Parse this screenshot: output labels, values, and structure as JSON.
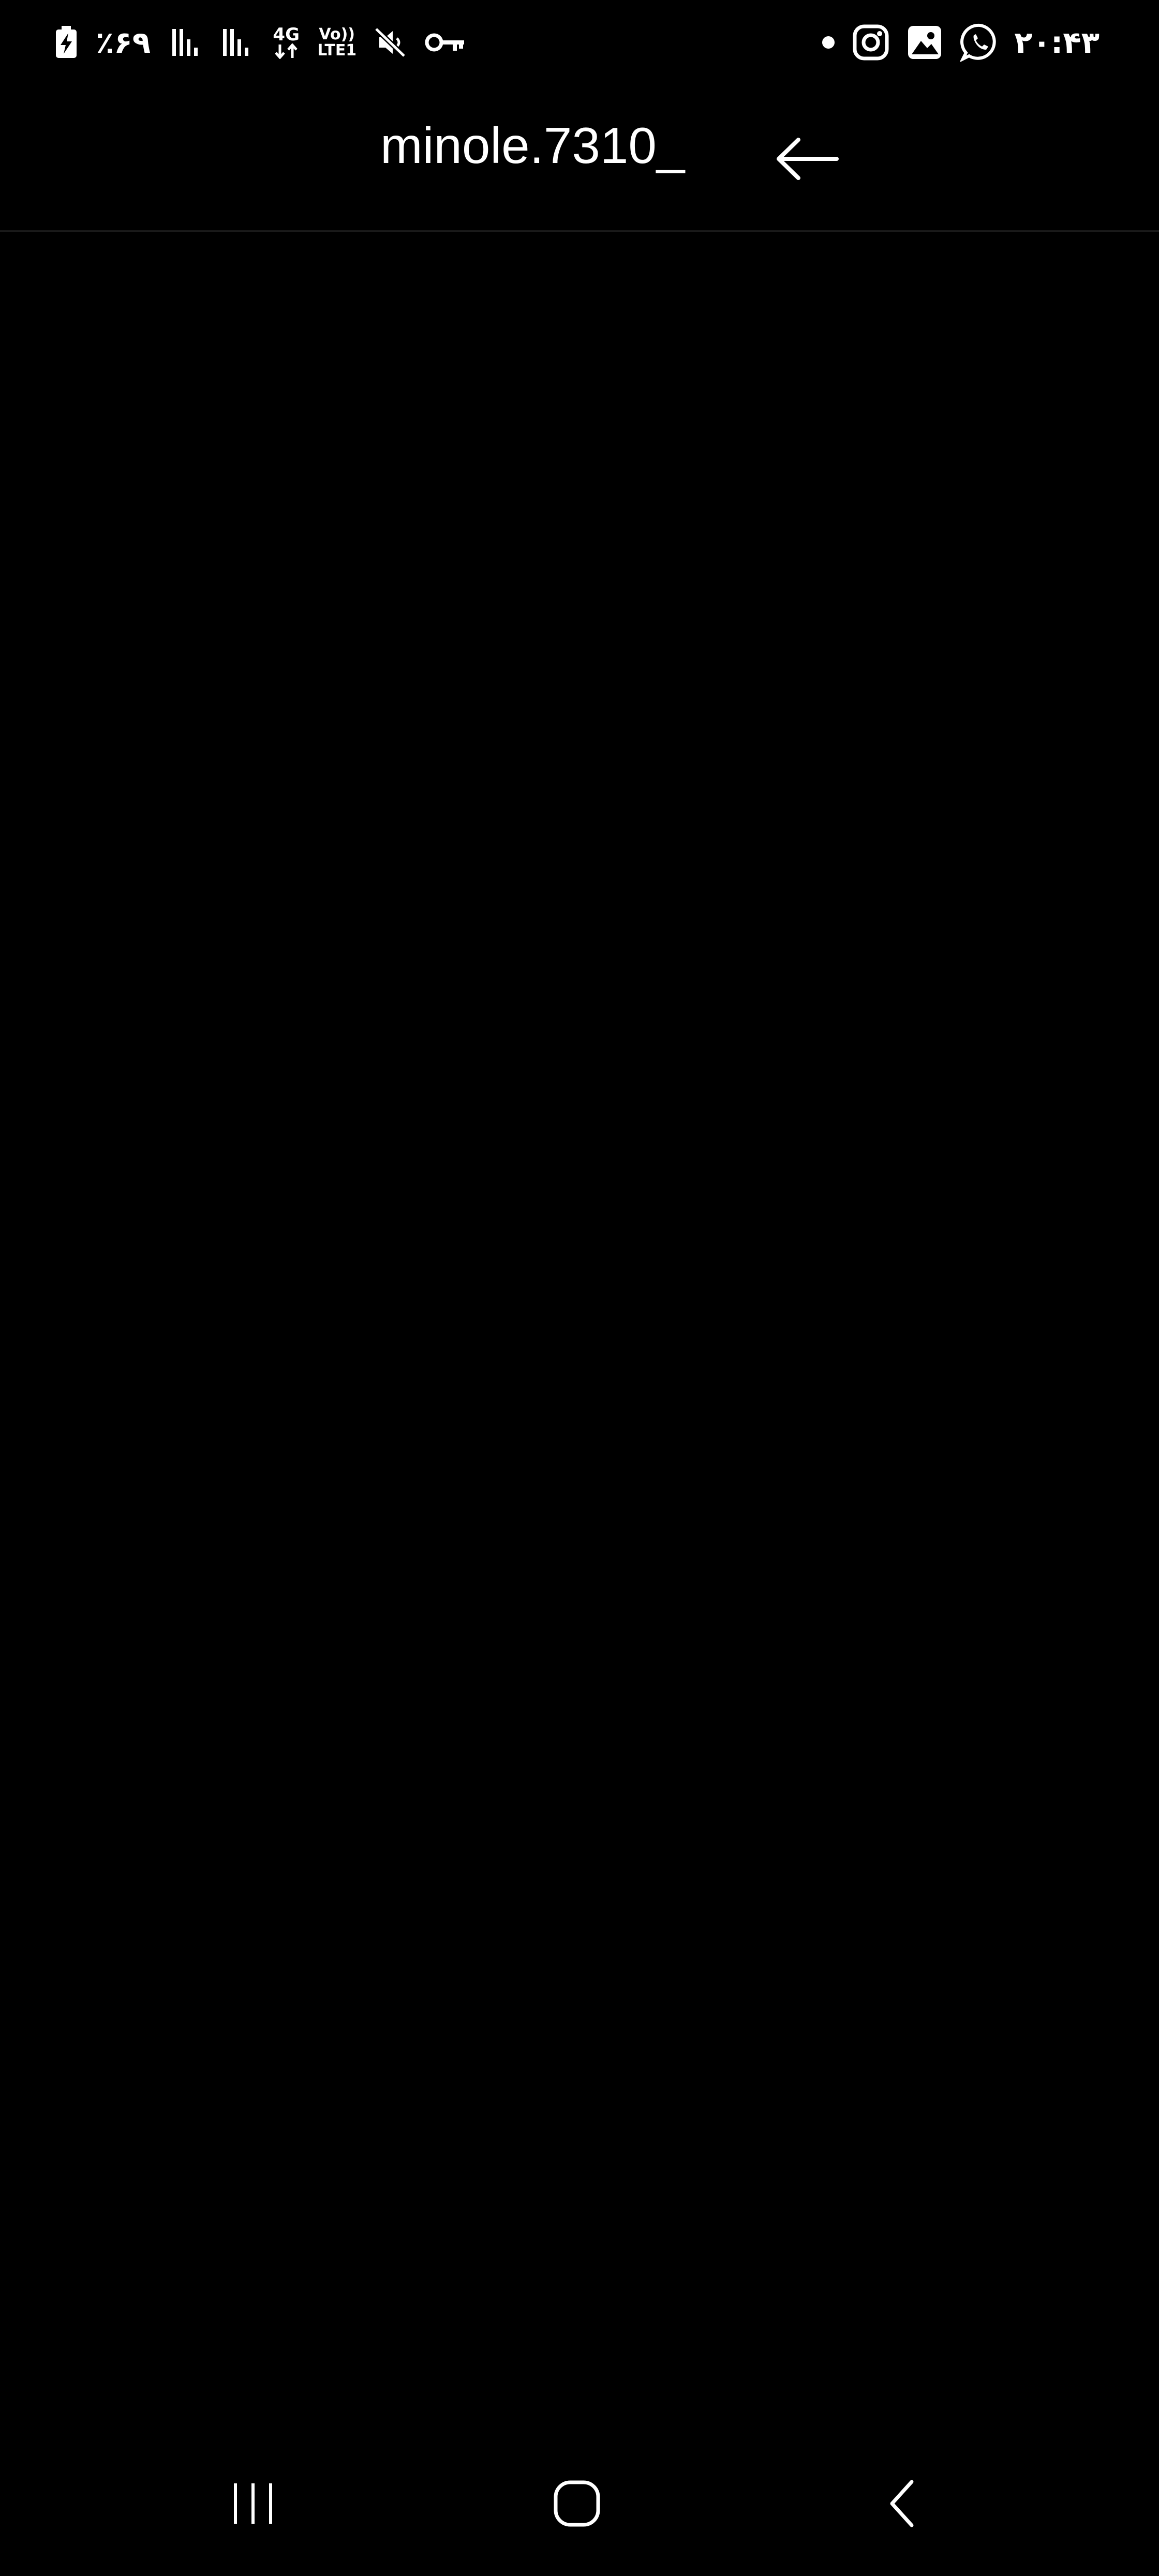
{
  "status_bar": {
    "battery_percent": "٪۶۹",
    "network_type": "4G",
    "volte_label_top": "Vo))",
    "volte_label_bottom": "LTE1",
    "time": "۲۰:۴۳",
    "icons_left": [
      "battery-charging-icon",
      "signal-bars-icon",
      "signal-bars-icon",
      "data-arrows-icon",
      "volte-icon",
      "mute-icon",
      "vpn-key-icon"
    ],
    "icons_right": [
      "notification-dot-icon",
      "instagram-icon",
      "gallery-icon",
      "whatsapp-icon"
    ]
  },
  "header": {
    "title": "minole.7310_",
    "back_icon": "arrow-left-icon"
  },
  "nav_bar": {
    "icons": [
      "recents-icon",
      "home-icon",
      "back-chevron-icon"
    ]
  },
  "colors": {
    "background": "#000000",
    "foreground": "#ffffff",
    "divider": "#1a1a1a"
  }
}
